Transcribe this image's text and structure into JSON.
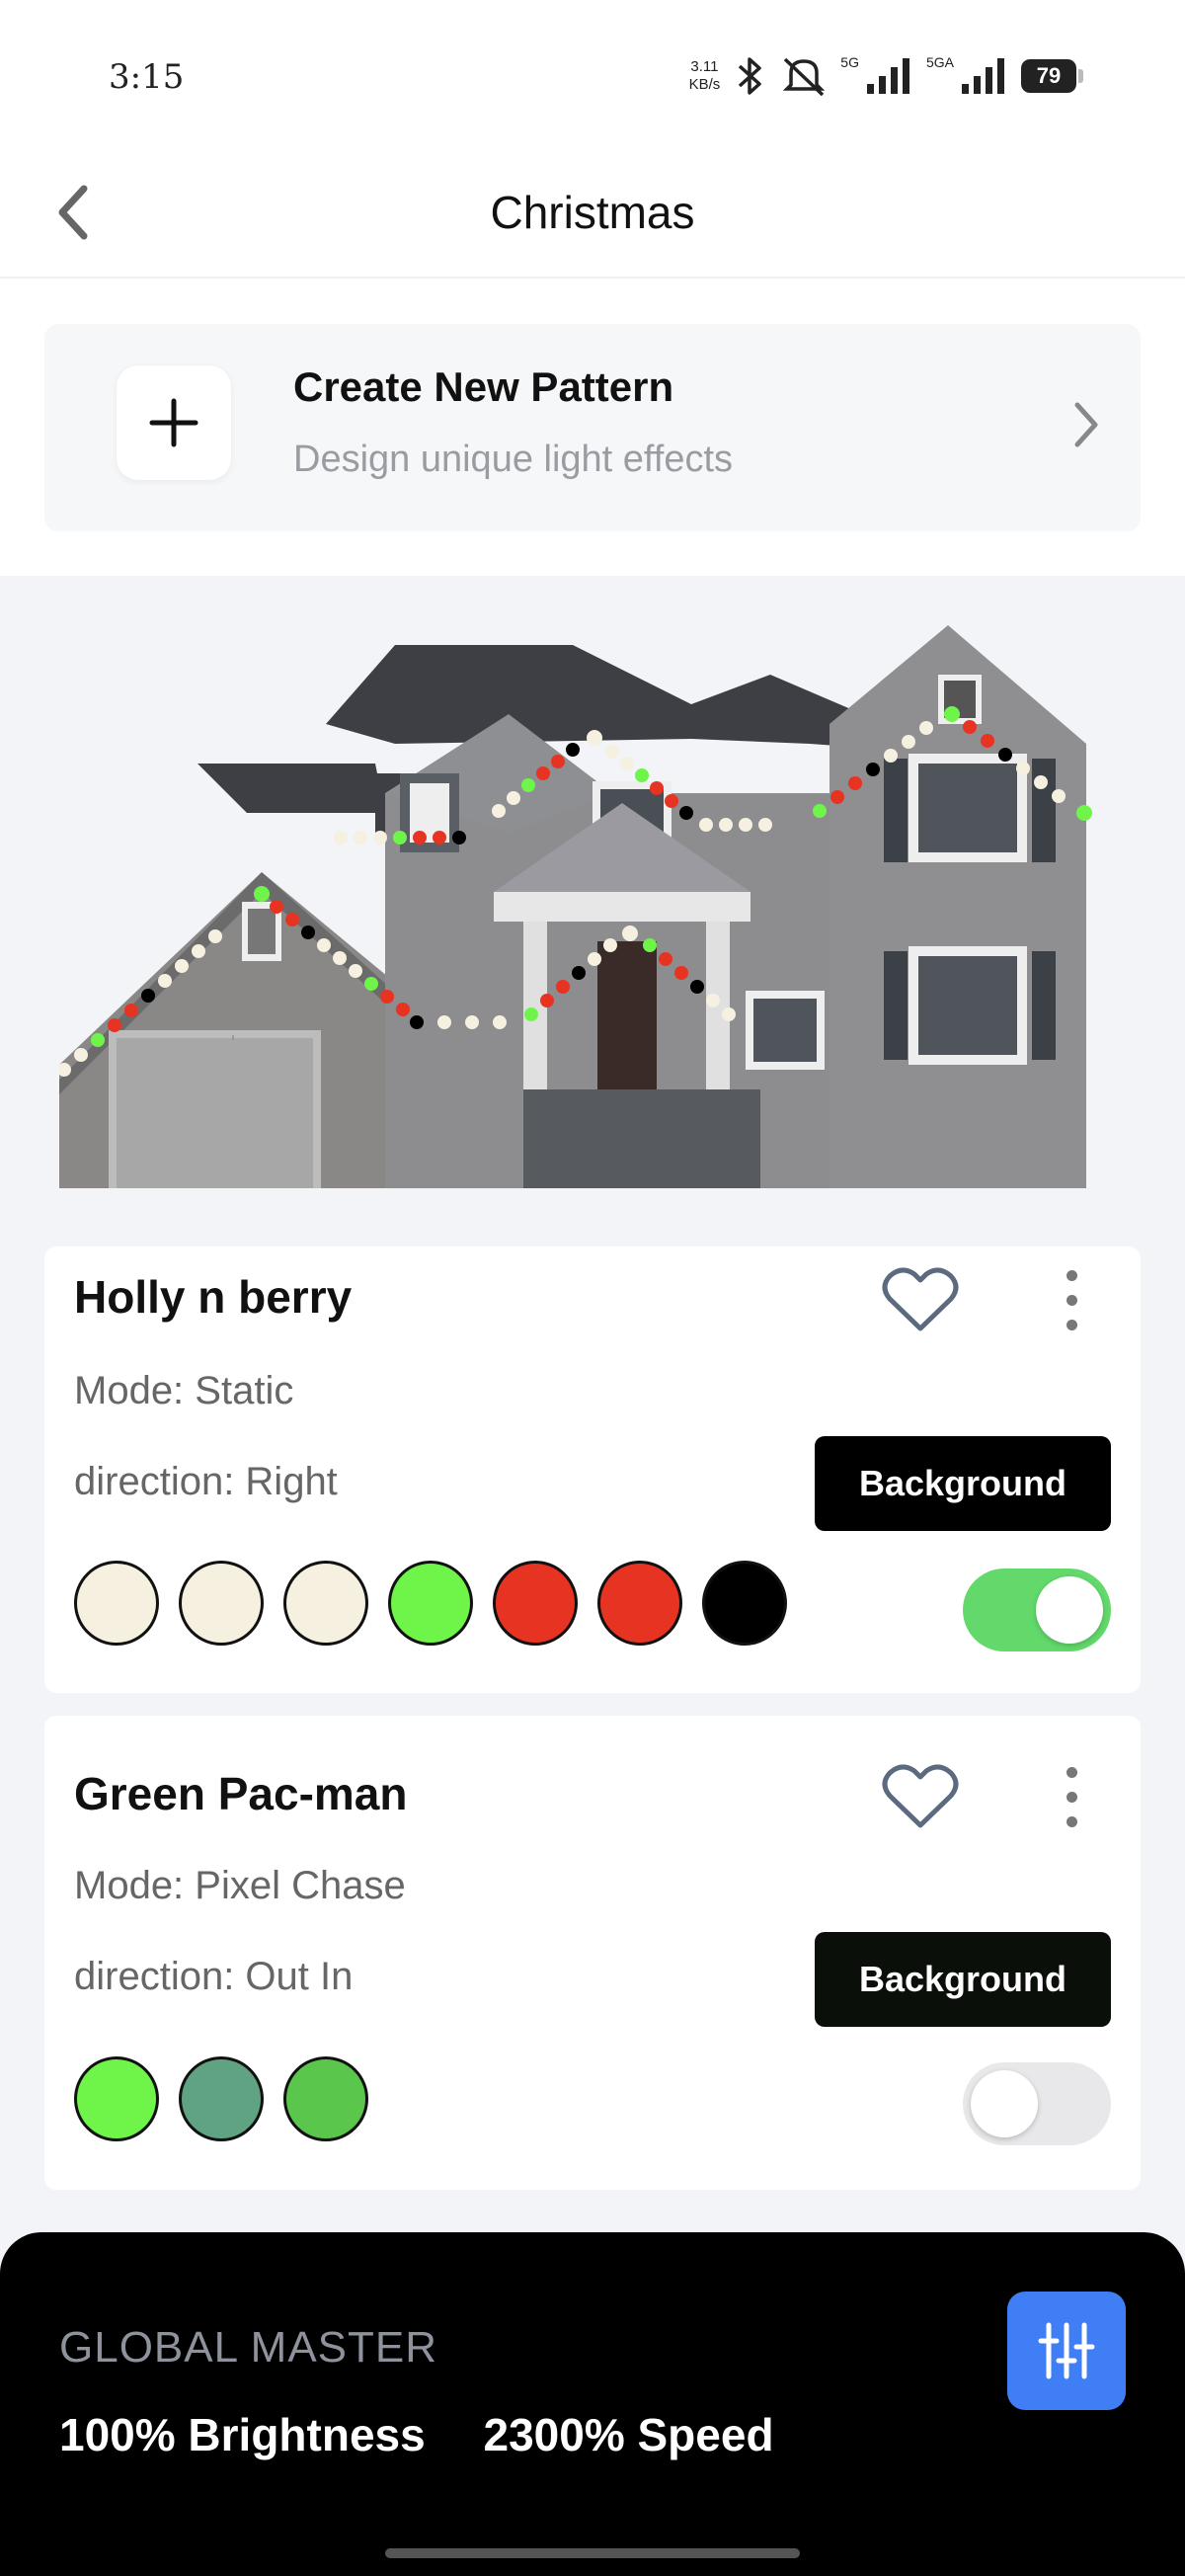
{
  "status_bar": {
    "time": "3:15",
    "net_speed_value": "3.11",
    "net_speed_unit": "KB/s",
    "signal1_label": "5G",
    "signal2_label": "5GA",
    "battery": "79",
    "icons": [
      "bluetooth-icon",
      "mute-icon",
      "signal-icon",
      "battery-icon"
    ]
  },
  "header": {
    "title": "Christmas",
    "back_icon": "chevron-left-icon"
  },
  "create_card": {
    "title": "Create New Pattern",
    "subtitle": "Design unique light effects",
    "icon": "plus-icon"
  },
  "patterns": [
    {
      "name": "Holly n berry",
      "mode": "Mode: Static",
      "direction": "direction: Right",
      "background_label": "Background",
      "enabled": true,
      "colors": [
        "#f6f0e0",
        "#f6f0e0",
        "#f6f0e0",
        "#6ff54a",
        "#e63322",
        "#e63322",
        "#000000"
      ]
    },
    {
      "name": "Green Pac-man",
      "mode": "Mode: Pixel Chase",
      "direction": "direction: Out In",
      "background_label": "Background",
      "enabled": false,
      "colors": [
        "#6ff54a",
        "#5fa382",
        "#5bc64c"
      ]
    }
  ],
  "global_master": {
    "label": "GLOBAL MASTER",
    "brightness": "100% Brightness",
    "speed": "2300% Speed",
    "settings_icon": "sliders-icon"
  },
  "colors": {
    "accent": "#3f7ef5",
    "toggle_on": "#63d96b",
    "light_warm": "#f6f0e0",
    "light_green": "#6ff54a",
    "light_red": "#e63322"
  }
}
